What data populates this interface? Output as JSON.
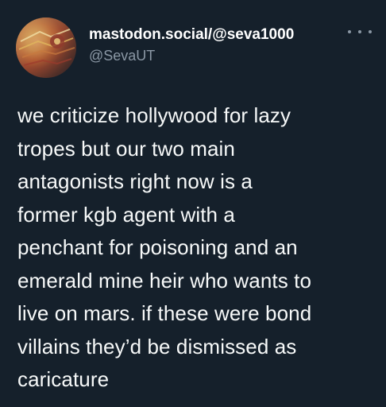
{
  "tweet": {
    "display_name": "mastodon.social/@seva1000",
    "handle": "@SevaUT",
    "more_icon": "more-horizontal-icon",
    "body_lines": [
      "we criticize hollywood for lazy",
      "tropes but our two main",
      "antagonists right now is a",
      "former kgb agent with a",
      "penchant for poisoning and an",
      "emerald mine heir who wants to",
      "live on mars. if these were bond",
      "villains they’d be dismissed as",
      "caricature"
    ]
  },
  "colors": {
    "background": "#15202b",
    "text": "#f7f9f9",
    "secondary_text": "#8b98a5"
  }
}
